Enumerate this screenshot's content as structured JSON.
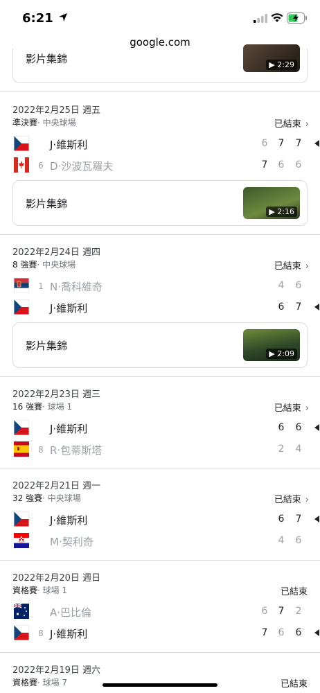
{
  "status_bar": {
    "time": "6:21"
  },
  "browser": {
    "url": "google.com"
  },
  "top_highlight": {
    "label": "影片集錦",
    "duration": "2:29"
  },
  "matches": [
    {
      "date": "2022年2月25日 週五",
      "round": "準決賽",
      "court": "· 中央球場",
      "status": "已結束",
      "players": [
        {
          "flag": "czech",
          "seed": "",
          "name": "J·維斯利",
          "winner": true,
          "sets": [
            "6",
            "7",
            "7"
          ],
          "set_wins": [
            false,
            true,
            true
          ]
        },
        {
          "flag": "canada",
          "seed": "6",
          "name": "D·沙波瓦羅夫",
          "winner": false,
          "sets": [
            "7",
            "6",
            "6"
          ],
          "set_wins": [
            true,
            false,
            false
          ]
        }
      ],
      "highlight": {
        "label": "影片集錦",
        "duration": "2:16"
      }
    },
    {
      "date": "2022年2月24日 週四",
      "round": "8 強賽",
      "court": "· 中央球場",
      "status": "已結束",
      "players": [
        {
          "flag": "serbia",
          "seed": "1",
          "name": "N·喬科維奇",
          "winner": false,
          "sets": [
            "4",
            "6"
          ]
        },
        {
          "flag": "czech",
          "seed": "",
          "name": "J·維斯利",
          "winner": true,
          "sets": [
            "6",
            "7"
          ]
        }
      ],
      "highlight": {
        "label": "影片集錦",
        "duration": "2:09"
      }
    },
    {
      "date": "2022年2月23日 週三",
      "round": "16 強賽",
      "court": "· 球場 1",
      "status": "已結束",
      "players": [
        {
          "flag": "czech",
          "seed": "",
          "name": "J·維斯利",
          "winner": true,
          "sets": [
            "6",
            "6"
          ]
        },
        {
          "flag": "spain",
          "seed": "8",
          "name": "R·包蒂斯塔",
          "winner": false,
          "sets": [
            "2",
            "4"
          ]
        }
      ]
    },
    {
      "date": "2022年2月21日 週一",
      "round": "32 強賽",
      "court": "· 中央球場",
      "status": "已結束",
      "players": [
        {
          "flag": "czech",
          "seed": "",
          "name": "J·維斯利",
          "winner": true,
          "sets": [
            "6",
            "7"
          ]
        },
        {
          "flag": "croatia",
          "seed": "",
          "name": "M·契利奇",
          "winner": false,
          "sets": [
            "4",
            "6"
          ]
        }
      ]
    },
    {
      "date": "2022年2月20日 週日",
      "round": "資格賽",
      "court": "· 球場 1",
      "status": "已結束",
      "players": [
        {
          "flag": "australia",
          "seed": "",
          "name": "A·巴比倫",
          "winner": false,
          "sets": [
            "6",
            "7",
            "2"
          ],
          "set_wins": [
            false,
            true,
            false
          ]
        },
        {
          "flag": "czech",
          "seed": "8",
          "name": "J·維斯利",
          "winner": true,
          "sets": [
            "7",
            "6",
            "6"
          ],
          "set_wins": [
            true,
            false,
            true
          ]
        }
      ]
    },
    {
      "date": "2022年2月19日 週六",
      "round": "資格賽",
      "court": "· 球場 7",
      "status": "已結束",
      "players": []
    }
  ],
  "colors": {
    "divider": "#dadce0",
    "winner_text": "#202124",
    "loser_text": "#9aa0a6"
  }
}
